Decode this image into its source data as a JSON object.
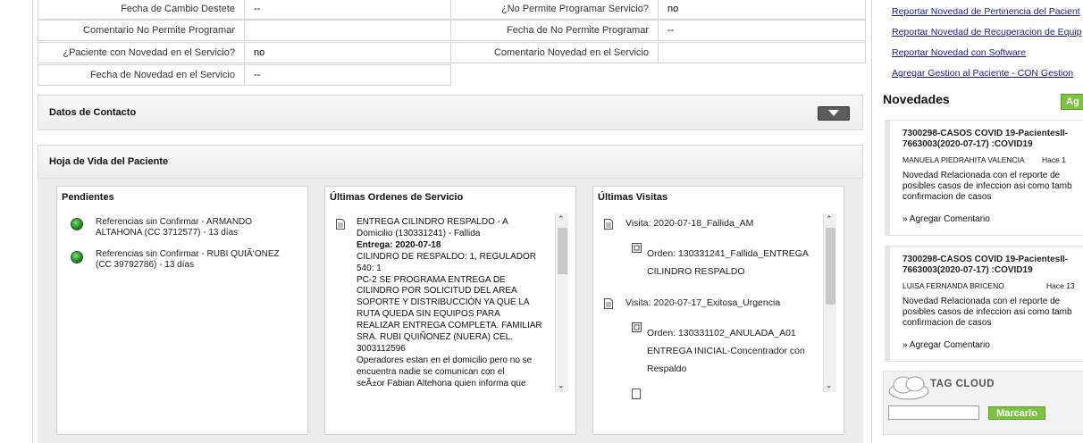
{
  "detail_rows": [
    {
      "label_left": "Fecha de Cambio Destete",
      "value_left": "--",
      "label_right": "¿No Permite Programar Servicio?",
      "value_right": "no"
    },
    {
      "label_left": "Comentario No Permite Programar",
      "value_left": "",
      "label_right": "Fecha de No Permite Programar",
      "value_right": "--"
    },
    {
      "label_left": "¿Paciente con Novedad en el Servicio?",
      "value_left": "no",
      "label_right": "Comentario Novedad en el Servicio",
      "value_right": ""
    },
    {
      "label_left": "Fecha de Novedad en el Servicio",
      "value_left": "--"
    }
  ],
  "contacto": {
    "title": "Datos de Contacto"
  },
  "hoja_vida": {
    "title": "Hoja de Vida del Paciente",
    "pendientes": {
      "title": "Pendientes",
      "items": [
        {
          "line1": "Referencias sin Confirmar - ARMANDO",
          "line2": "ALTAHONA (CC 3712577) - 13 días"
        },
        {
          "line1": "Referencias sin Confirmar - RUBI QUIÃ‘ONEZ",
          "line2": "(CC 39792786) - 13 días"
        }
      ]
    },
    "ordenes": {
      "title": "Últimas Ordenes de Servicio",
      "lines": [
        "ENTREGA CILINDRO RESPALDO - A",
        "Domicilio (130331241) - Fallida",
        "Entrega: 2020-07-18",
        "CILINDRO DE RESPALDO: 1, REGULADOR",
        "540: 1",
        "PC-2 SE PROGRAMA ENTREGA DE",
        "CILINDRO POR SOLICITUD DEL AREA",
        "SOPORTE Y DISTRIBUCCIÓN YA QUE LA",
        "RUTA QUEDA SIN EQUIPOS PARA",
        "REALIZAR ENTREGA COMPLETA. FAMILIAR",
        "SRA. RUBI QUIÑONEZ (NUERA) CEL.",
        "3003112596",
        "Operadores estan en el domicilio pero no se",
        "encuentra nadie se comunican con el",
        "seÃ±or Fabian Altehona quien informa que"
      ]
    },
    "visitas": {
      "title": "Últimas Visitas",
      "items": [
        {
          "visita": "Visita: 2020-07-18_Fallida_AM",
          "orden_lines": [
            "Orden: 130331241_Fallida_ENTREGA",
            "CILINDRO RESPALDO"
          ]
        },
        {
          "visita": "Visita: 2020-07-17_Exitosa_Urgencia",
          "orden_lines": [
            "Orden: 130331102_ANULADA_A01",
            "ENTREGA INICIAL-Concentrador con",
            "Respaldo"
          ]
        }
      ]
    }
  },
  "right_links": [
    "Reportar Novedad de Pertinencia del Pacient",
    "Reportar Novedad de Recuperacion de Equip",
    "Reportar Novedad con Software",
    "Agregar Gestion al Paciente - CON Gestion"
  ],
  "novedades": {
    "title": "Novedades",
    "add_label": "Ag",
    "cards": [
      {
        "title1": "7300298-CASOS COVID 19-PacientesII-",
        "title2": "7663003(2020-07-17) :COVID19",
        "user": "MANUELA PIEDRAHITA VALENCIA",
        "time": "Hace 1",
        "text": [
          "Novedad Relacionada con el reporte de",
          "posibles casos de infeccion asi como tamb",
          "confirmacion de casos"
        ],
        "comment": "» Agregar Comentario"
      },
      {
        "title1": "7300298-CASOS COVID 19-PacientesII-",
        "title2": "7663003(2020-07-17) :COVID19",
        "user": "LUISA FERNANDA BRICENO",
        "time": "Hace 13",
        "text": [
          "Novedad Relacionada con el reporte de",
          "posibles casos de infeccion asi como tamb",
          "confirmacion de casos"
        ],
        "comment": "» Agregar Comentario"
      }
    ]
  },
  "tag_cloud": {
    "title": "TAG CLOUD",
    "input_value": "",
    "button_label": "Marcarlo"
  }
}
